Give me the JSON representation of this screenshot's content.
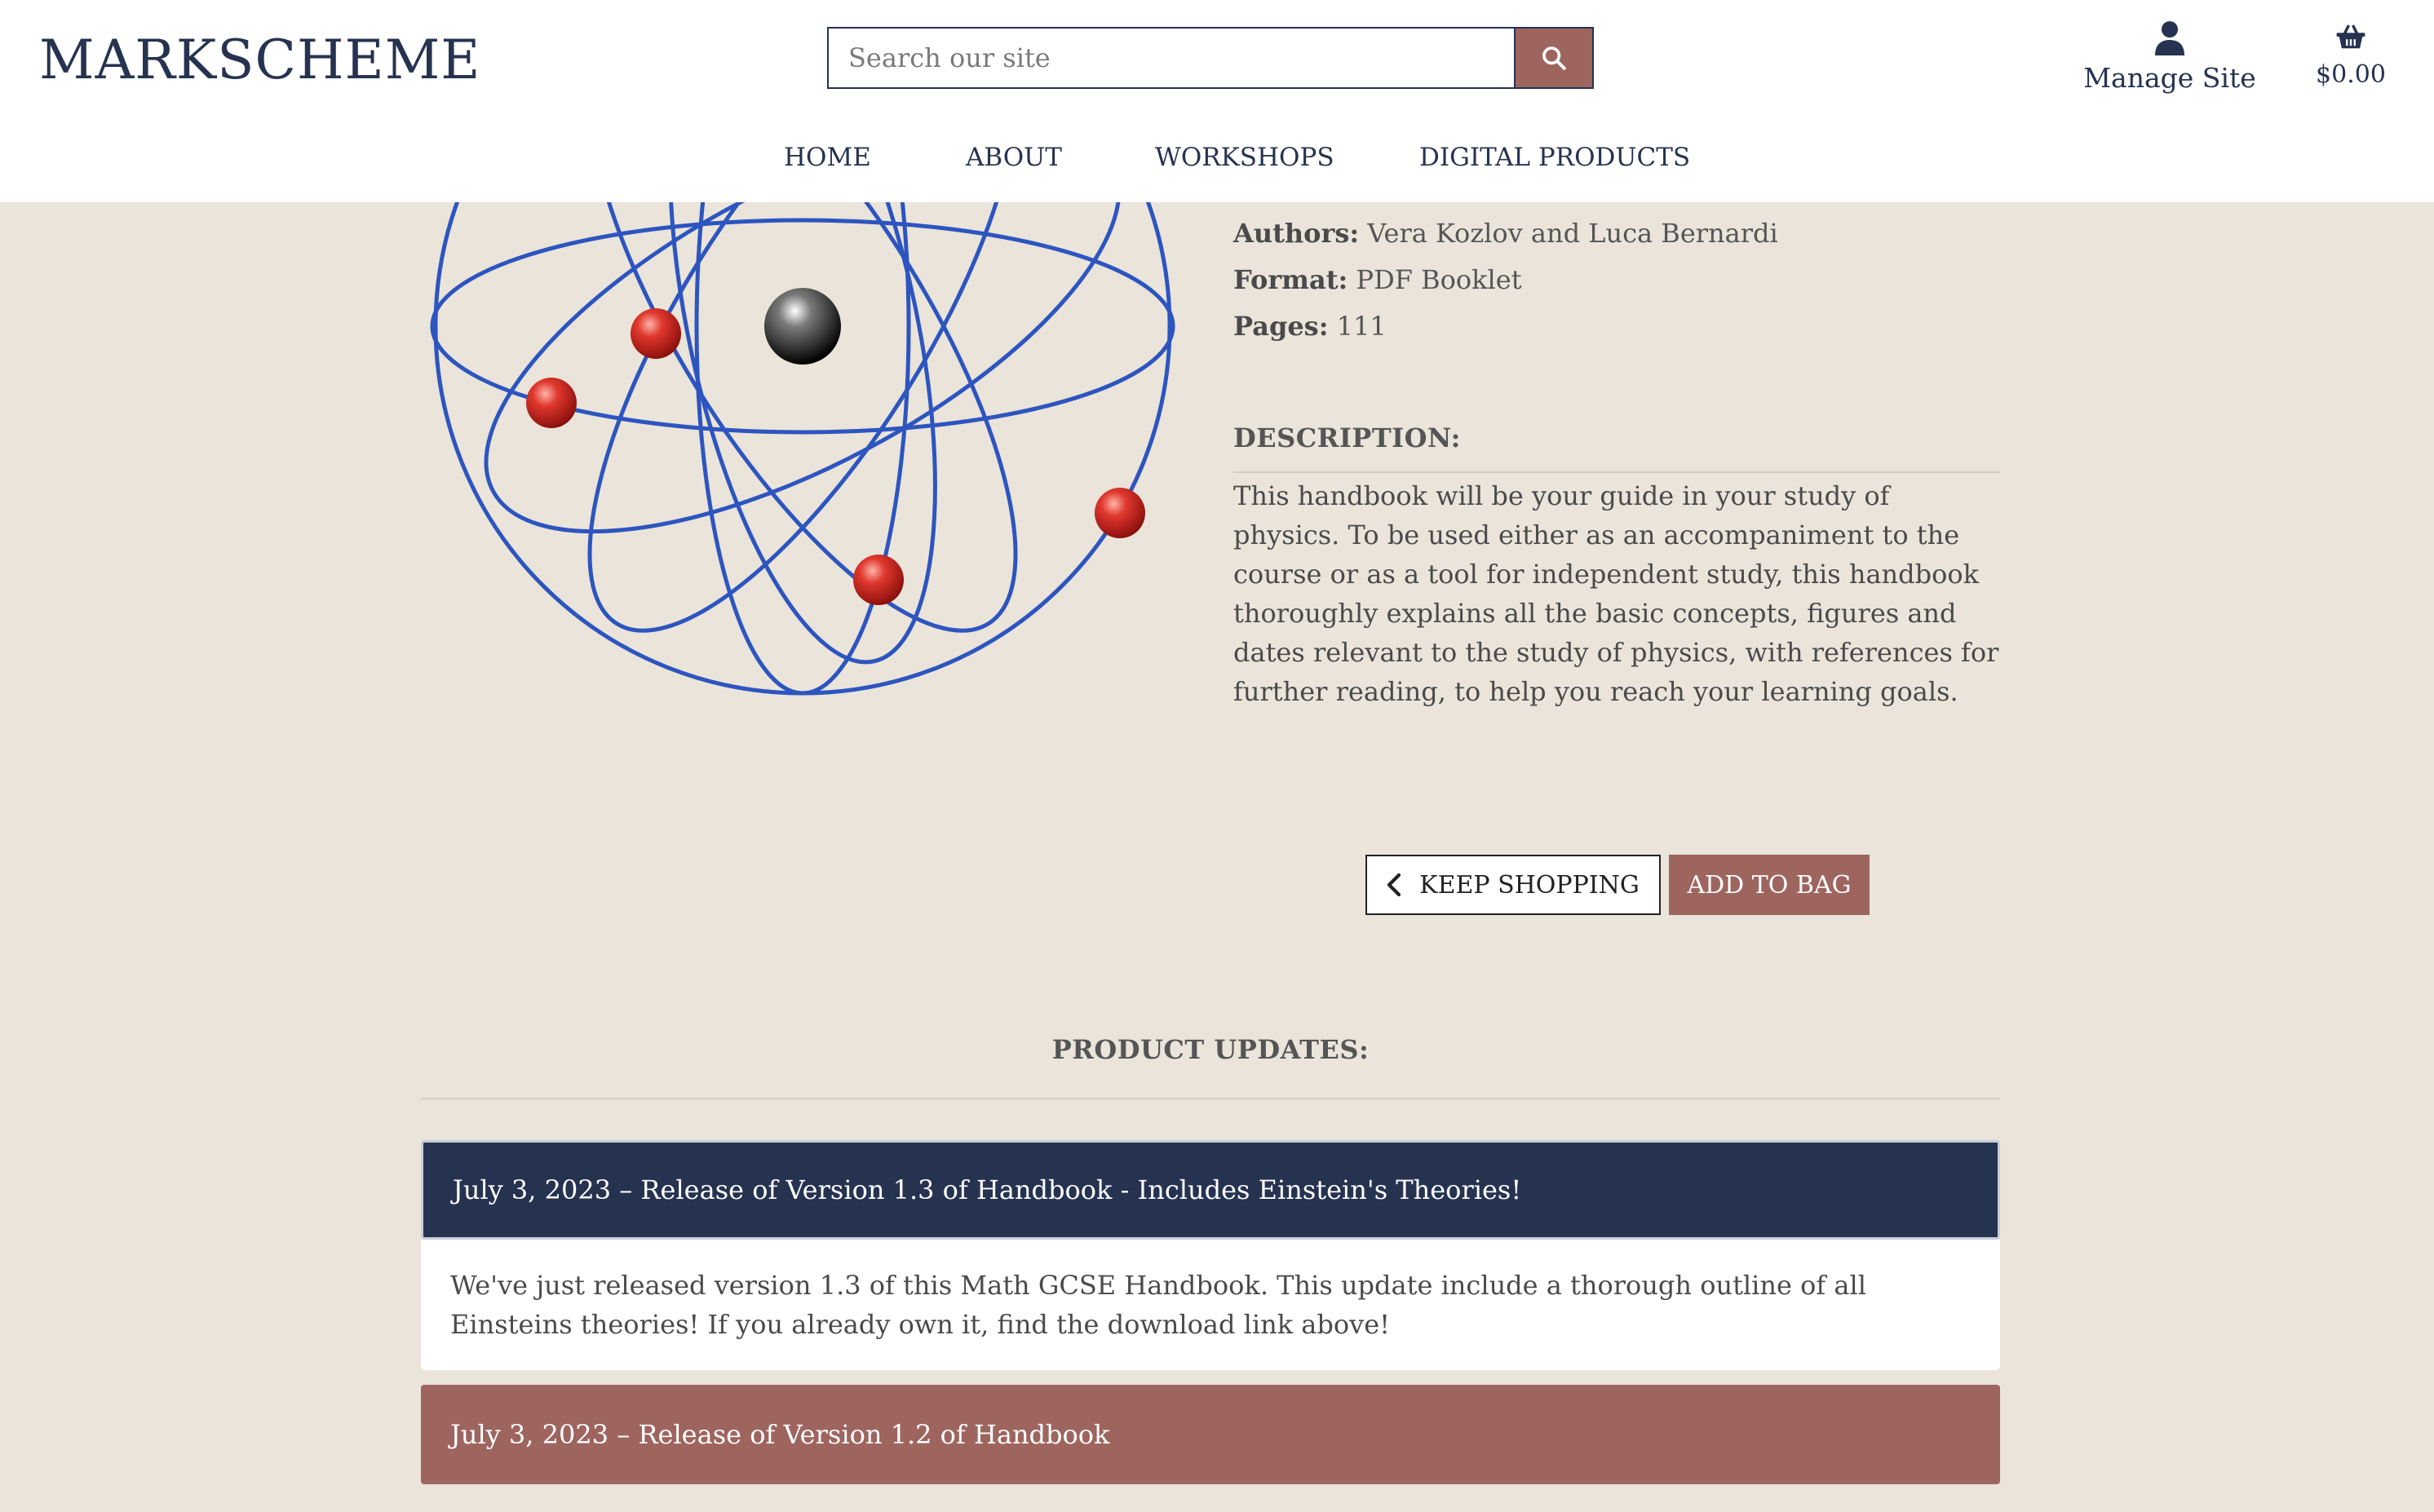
{
  "header": {
    "logo": "MARKSCHEME",
    "search": {
      "placeholder": "Search our site",
      "button_icon": "search-icon"
    },
    "account": {
      "icon": "user-icon",
      "label": "Manage Site"
    },
    "bag": {
      "icon": "basket-icon",
      "total": "$0.00"
    },
    "nav": [
      {
        "label": "HOME"
      },
      {
        "label": "ABOUT"
      },
      {
        "label": "WORKSHOPS"
      },
      {
        "label": "DIGITAL PRODUCTS"
      }
    ]
  },
  "product": {
    "image": "atom-model-illustration",
    "meta": {
      "authors_label": "Authors:",
      "authors": "Vera Kozlov and Luca Bernardi",
      "format_label": "Format:",
      "format": "PDF Booklet",
      "pages_label": "Pages:",
      "pages": "111"
    },
    "description_heading": "DESCRIPTION:",
    "description": "This handbook will be your guide in your study of physics. To be used either as an accompaniment to the course or as a tool for independent study, this handbook thoroughly explains all the basic concepts, figures and dates relevant to the study of physics, with references for further reading, to help you reach your learning goals.",
    "keep_shopping_label": "KEEP SHOPPING",
    "add_to_bag_label": "ADD TO BAG"
  },
  "updates": {
    "heading": "PRODUCT UPDATES:",
    "items": [
      {
        "title": "July 3, 2023 – Release of Version 1.3 of Handbook - Includes Einstein's Theories!",
        "body": "We've just released version 1.3 of this Math GCSE Handbook. This update include a thorough outline of all Einsteins theories! If you already own it, find the download link above!",
        "expanded": true
      },
      {
        "title": "July 3, 2023 – Release of Version 1.2 of Handbook",
        "expanded": false
      }
    ]
  },
  "colors": {
    "page_bg": "#eae4da",
    "navy": "#263350",
    "rose": "#9e655f",
    "header_bg": "#ffffff"
  }
}
